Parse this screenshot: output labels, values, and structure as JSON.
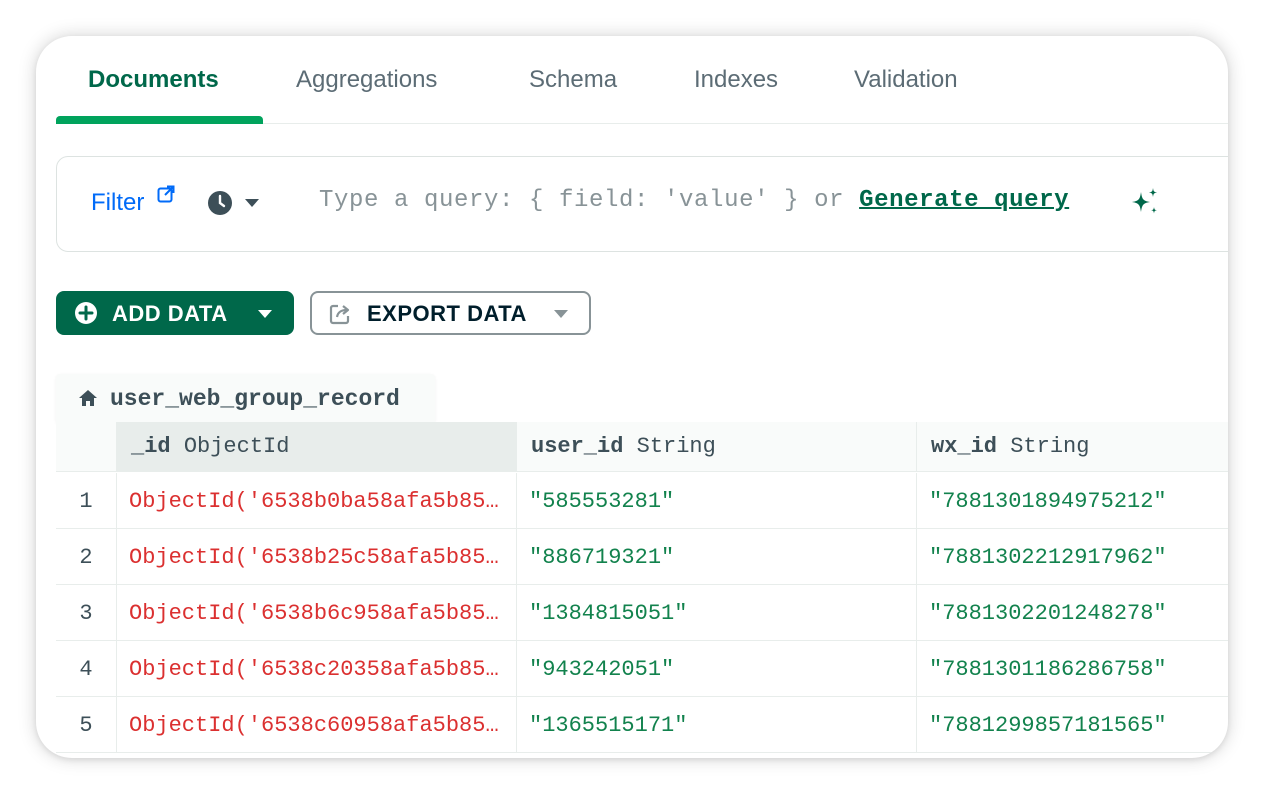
{
  "tabs": [
    {
      "label": "Documents",
      "active": true
    },
    {
      "label": "Aggregations",
      "active": false
    },
    {
      "label": "Schema",
      "active": false
    },
    {
      "label": "Indexes",
      "active": false
    },
    {
      "label": "Validation",
      "active": false
    }
  ],
  "filter": {
    "label": "Filter",
    "placeholder": "Type a query: { field: 'value' } or ",
    "generate_label": "Generate query"
  },
  "toolbar": {
    "add_data_label": "ADD DATA",
    "export_data_label": "EXPORT DATA"
  },
  "collection": {
    "name": "user_web_group_record"
  },
  "table": {
    "columns": [
      {
        "name": "_id",
        "type": "ObjectId"
      },
      {
        "name": "user_id",
        "type": "String"
      },
      {
        "name": "wx_id",
        "type": "String"
      }
    ],
    "rows": [
      {
        "num": "1",
        "id": "ObjectId('6538b0ba58afa5b85…",
        "user_id": "\"585553281\"",
        "wx_id": "\"7881301894975212\""
      },
      {
        "num": "2",
        "id": "ObjectId('6538b25c58afa5b85…",
        "user_id": "\"886719321\"",
        "wx_id": "\"7881302212917962\""
      },
      {
        "num": "3",
        "id": "ObjectId('6538b6c958afa5b85…",
        "user_id": "\"1384815051\"",
        "wx_id": "\"7881302201248278\""
      },
      {
        "num": "4",
        "id": "ObjectId('6538c20358afa5b85…",
        "user_id": "\"943242051\"",
        "wx_id": "\"7881301186286758\""
      },
      {
        "num": "5",
        "id": "ObjectId('6538c60958afa5b85…",
        "user_id": "\"1365515171\"",
        "wx_id": "\"7881299857181565\""
      }
    ]
  },
  "colors": {
    "accent": "#00684a",
    "accent_bright": "#00a35c",
    "link": "#016bf8",
    "objectid": "#db3030",
    "string": "#12824d"
  },
  "icons": {
    "filter_link": "external-link-icon",
    "history": "clock-icon",
    "generate": "sparkle-icon",
    "add": "plus-circle-icon",
    "export": "export-icon",
    "collection": "home-icon"
  }
}
